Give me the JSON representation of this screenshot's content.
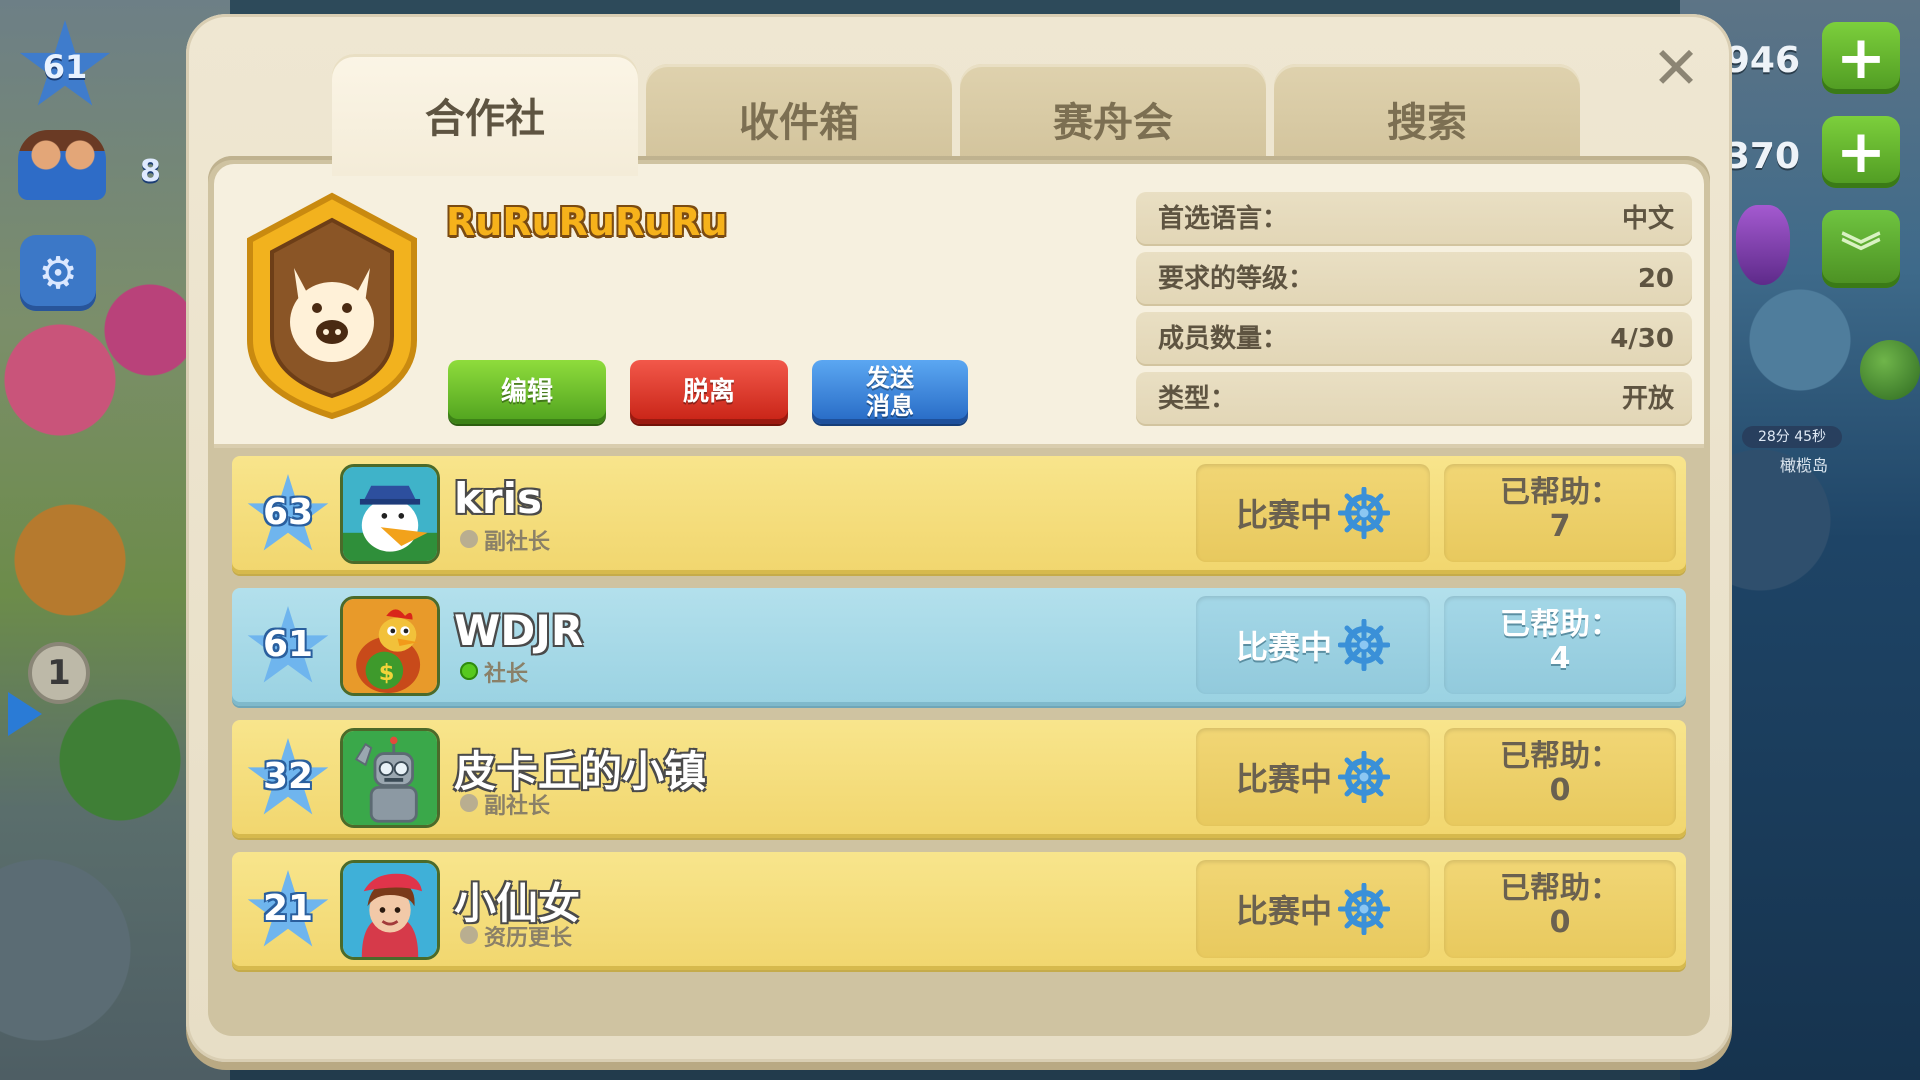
{
  "hud": {
    "player_level": "61",
    "population": "8",
    "coins": "946",
    "cash": "370",
    "timer": "28分 45秒",
    "island_label": "橄榄岛",
    "notification_count": "1"
  },
  "tabs": [
    {
      "label": "合作社",
      "active": true
    },
    {
      "label": "收件箱",
      "active": false
    },
    {
      "label": "赛舟会",
      "active": false
    },
    {
      "label": "搜索",
      "active": false
    }
  ],
  "coop": {
    "name": "RuRuRuRuRu",
    "buttons": {
      "edit": "编辑",
      "leave": "脱离",
      "send_line1": "发送",
      "send_line2": "消息"
    },
    "info": [
      {
        "label": "首选语言：",
        "value": "中文"
      },
      {
        "label": "要求的等级：",
        "value": "20"
      },
      {
        "label": "成员数量：",
        "value": "4/30"
      },
      {
        "label": "类型：",
        "value": "开放"
      }
    ]
  },
  "members": [
    {
      "level": "63",
      "name": "kris",
      "role": "副社长",
      "online": false,
      "self": false,
      "status": "比赛中",
      "helped_label": "已帮助：",
      "helped": "7"
    },
    {
      "level": "61",
      "name": "WDJR",
      "role": "社长",
      "online": true,
      "self": true,
      "status": "比赛中",
      "helped_label": "已帮助：",
      "helped": "4"
    },
    {
      "level": "32",
      "name": "皮卡丘的小镇",
      "role": "副社长",
      "online": false,
      "self": false,
      "status": "比赛中",
      "helped_label": "已帮助：",
      "helped": "0"
    },
    {
      "level": "21",
      "name": "小仙女",
      "role": "资历更长",
      "online": false,
      "self": false,
      "status": "比赛中",
      "helped_label": "已帮助：",
      "helped": "0"
    }
  ],
  "colors": {
    "name_gold": "#f6b21b",
    "member_row": "#f1d66e",
    "self_row": "#9ad2e2",
    "level_star": "#6fb5ee",
    "edit_green": "#4fa11e",
    "leave_red": "#c72215",
    "send_blue": "#2669c4"
  }
}
